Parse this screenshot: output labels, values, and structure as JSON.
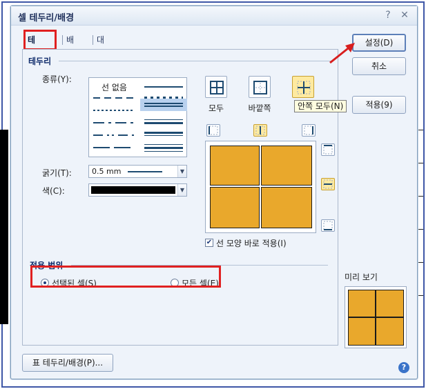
{
  "dialog": {
    "title": "셀 테두리/배경",
    "help_glyph": "?",
    "close_glyph": "✕"
  },
  "tabs": [
    {
      "label": "테두리",
      "active": true
    },
    {
      "label": "배경",
      "active": false
    },
    {
      "label": "대각선",
      "active": false
    }
  ],
  "border_section": {
    "title": "테두리",
    "type_label": "종류(Y):",
    "no_line_label": "선 없음",
    "thickness_label": "굵기(T):",
    "thickness_value": "0.5 mm",
    "color_label": "색(C):",
    "color_value": "#000000",
    "presets": [
      {
        "label": "모두",
        "icon": "all-borders-icon"
      },
      {
        "label": "바깥쪽",
        "icon": "outer-border-icon"
      },
      {
        "label": "안쪽",
        "icon": "inner-border-icon"
      }
    ],
    "tooltip": "안쪽 모두(N)",
    "apply_immediately_label": "선 모양 바로 적용(I)",
    "apply_immediately_checked": true
  },
  "scope_section": {
    "title": "적용 범위",
    "options": [
      {
        "label": "선택된 셀(S)",
        "selected": true
      },
      {
        "label": "모든 셀(E)",
        "selected": false
      }
    ]
  },
  "buttons": {
    "ok": "설정(D)",
    "cancel": "취소",
    "apply": "적용(9)",
    "table_border": "표 테두리/배경(P)..."
  },
  "preview_label": "미리 보기",
  "colors": {
    "cell_fill": "#e9a82c",
    "highlight": "#e02020",
    "accent": "#3d56a6"
  }
}
